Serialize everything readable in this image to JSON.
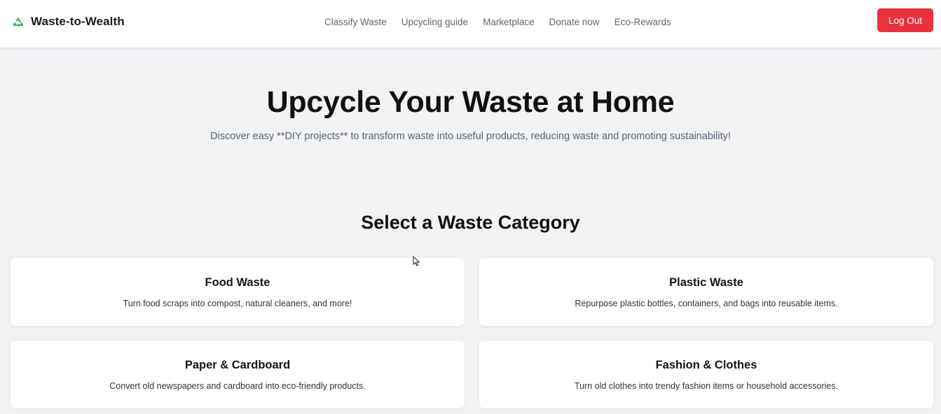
{
  "nav": {
    "brand": "Waste-to-Wealth",
    "brand_icon": "recycle-icon",
    "links": [
      "Classify Waste",
      "Upcycling guide",
      "Marketplace",
      "Donate now",
      "Eco-Rewards"
    ],
    "logout": "Log Out"
  },
  "hero": {
    "title": "Upcycle Your Waste at Home",
    "subtitle": "Discover easy **DIY projects** to transform waste into useful products, reducing waste and promoting sustainability!"
  },
  "section": {
    "title": "Select a Waste Category"
  },
  "categories": [
    {
      "title": "Food Waste",
      "description": "Turn food scraps into compost, natural cleaners, and more!"
    },
    {
      "title": "Plastic Waste",
      "description": "Repurpose plastic bottles, containers, and bags into reusable items."
    },
    {
      "title": "Paper & Cardboard",
      "description": "Convert old newspapers and cardboard into eco-friendly products."
    },
    {
      "title": "Fashion & Clothes",
      "description": "Turn old clothes into trendy fashion items or household accessories."
    }
  ],
  "colors": {
    "accent_red": "#e8323e",
    "brand_green": "#2e9e54",
    "background": "#f1f2f4"
  }
}
